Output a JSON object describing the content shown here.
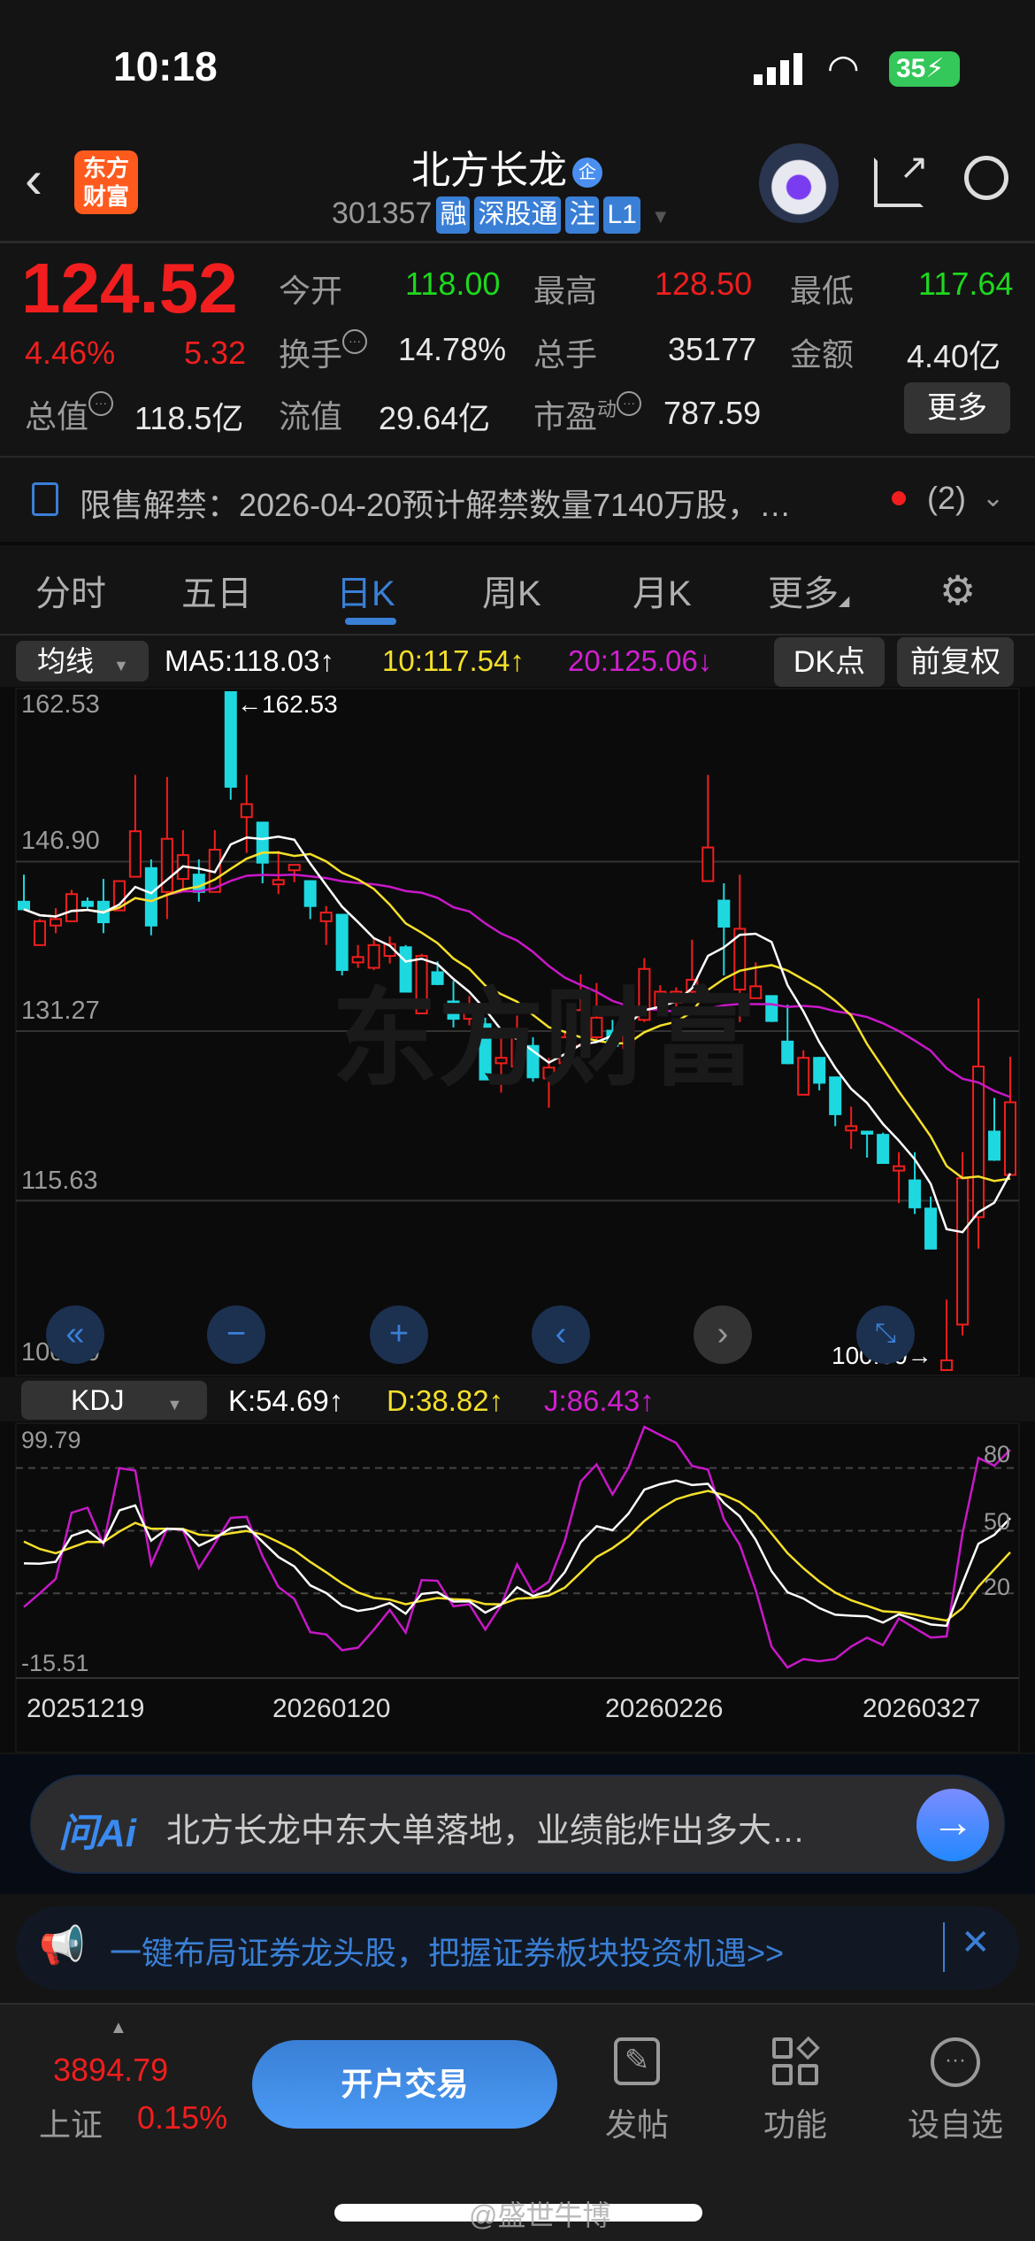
{
  "status": {
    "time": "10:18",
    "battery": "35"
  },
  "header": {
    "logo": "东方财富",
    "title": "北方长龙",
    "title_badge": "企",
    "code": "301357",
    "tags": [
      "融",
      "深股通",
      "注",
      "L1"
    ]
  },
  "quote": {
    "price": "124.52",
    "pct": "4.46%",
    "change": "5.32",
    "open_label": "今开",
    "open": "118.00",
    "high_label": "最高",
    "high": "128.50",
    "low_label": "最低",
    "low": "117.64",
    "turnover_label": "换手",
    "turnover": "14.78%",
    "volume_label": "总手",
    "volume": "35177",
    "amount_label": "金额",
    "amount": "4.40亿",
    "mcap_label": "总值",
    "mcap": "118.5亿",
    "float_label": "流值",
    "float": "29.64亿",
    "pe_label": "市盈",
    "pe_sup": "动",
    "pe": "787.59",
    "more": "更多"
  },
  "notice": {
    "text": "限售解禁：2026-04-20预计解禁数量7140万股，…",
    "count": "(2)"
  },
  "tabs": [
    "分时",
    "五日",
    "日K",
    "周K",
    "月K",
    "更多"
  ],
  "active_tab": 2,
  "ma_bar": {
    "selector": "均线",
    "ma5": "MA5:118.03↑",
    "ma10": "10:117.54↑",
    "ma20": "20:125.06↓",
    "dk": "DK点",
    "adjust": "前复权"
  },
  "kdj_bar": {
    "selector": "KDJ",
    "k": "K:54.69↑",
    "d": "D:38.82↑",
    "j": "J:86.43↑"
  },
  "colors": {
    "up": "#f01e1e",
    "down": "#1ed8e0",
    "ma5": "#ffffff",
    "ma10": "#f5e02a",
    "ma20": "#c818c8",
    "accent": "#3a7fd6"
  },
  "chart_data": {
    "type": "candlestick",
    "ylim": [
      100.0,
      162.53
    ],
    "y_ticks": [
      "162.53",
      "146.90",
      "131.27",
      "115.63",
      "100.00"
    ],
    "max_label": "←162.53",
    "min_label": "100.00→",
    "x_labels": [
      "20251219",
      "20260120",
      "20260226",
      "20260327"
    ],
    "ohlc": [
      [
        143.2,
        145.7,
        142.4,
        142.5
      ],
      [
        139.2,
        141.6,
        139.2,
        141.4
      ],
      [
        141.0,
        142.6,
        140.3,
        141.6
      ],
      [
        141.4,
        144.3,
        141.3,
        143.9
      ],
      [
        143.2,
        143.6,
        142.5,
        142.8
      ],
      [
        143.2,
        145.3,
        140.3,
        141.3
      ],
      [
        142.4,
        145.1,
        142.4,
        145.1
      ],
      [
        145.5,
        154.9,
        145.5,
        149.7
      ],
      [
        146.3,
        147.1,
        140.1,
        141.0
      ],
      [
        144.1,
        154.7,
        141.6,
        149.0
      ],
      [
        145.3,
        149.8,
        144.3,
        147.5
      ],
      [
        145.7,
        147.1,
        143.2,
        144.1
      ],
      [
        144.1,
        149.8,
        144.1,
        148.0
      ],
      [
        162.53,
        162.53,
        152.6,
        153.8
      ],
      [
        151.0,
        154.9,
        147.7,
        152.2
      ],
      [
        150.5,
        150.5,
        144.9,
        146.8
      ],
      [
        144.8,
        147.9,
        143.9,
        145.2
      ],
      [
        146.1,
        146.6,
        145.0,
        146.6
      ],
      [
        145.1,
        145.1,
        141.6,
        142.8
      ],
      [
        141.4,
        142.8,
        139.2,
        142.2
      ],
      [
        142.0,
        142.0,
        136.4,
        136.9
      ],
      [
        137.6,
        139.2,
        137.1,
        138.1
      ],
      [
        137.1,
        139.8,
        136.9,
        139.2
      ],
      [
        138.2,
        140.0,
        137.5,
        139.3
      ],
      [
        139.0,
        139.2,
        134.9,
        134.9
      ],
      [
        132.9,
        138.4,
        132.9,
        138.2
      ],
      [
        136.7,
        137.7,
        135.5,
        135.6
      ],
      [
        134.0,
        135.9,
        131.6,
        132.4
      ],
      [
        132.4,
        134.5,
        131.8,
        133.3
      ],
      [
        131.9,
        132.5,
        126.8,
        126.8
      ],
      [
        128.3,
        131.4,
        125.6,
        128.8
      ],
      [
        128.0,
        132.7,
        127.8,
        131.3
      ],
      [
        129.9,
        130.7,
        126.6,
        127.0
      ],
      [
        126.9,
        128.8,
        124.2,
        127.9
      ],
      [
        128.3,
        131.1,
        128.3,
        130.7
      ],
      [
        129.9,
        136.5,
        129.9,
        133.2
      ],
      [
        130.7,
        135.7,
        130.4,
        132.5
      ],
      [
        131.3,
        132.3,
        129.7,
        129.9
      ],
      [
        129.7,
        134.9,
        129.5,
        133.3
      ],
      [
        132.3,
        138.0,
        132.1,
        137.0
      ],
      [
        133.3,
        135.5,
        132.7,
        134.9
      ],
      [
        133.9,
        135.3,
        132.9,
        134.9
      ],
      [
        134.9,
        139.7,
        134.6,
        136.0
      ],
      [
        145.1,
        154.9,
        145.1,
        148.2
      ],
      [
        143.3,
        144.9,
        136.4,
        140.9
      ],
      [
        135.1,
        145.7,
        132.1,
        140.7
      ],
      [
        134.3,
        137.6,
        134.3,
        135.4
      ],
      [
        134.5,
        134.5,
        132.1,
        132.2
      ],
      [
        130.3,
        133.7,
        128.2,
        128.3
      ],
      [
        125.4,
        129.5,
        125.4,
        128.8
      ],
      [
        128.8,
        128.9,
        125.8,
        126.5
      ],
      [
        127.0,
        127.0,
        122.5,
        123.6
      ],
      [
        122.1,
        124.3,
        120.4,
        122.5
      ],
      [
        122.0,
        122.0,
        119.6,
        121.8
      ],
      [
        121.7,
        121.9,
        119.1,
        119.1
      ],
      [
        118.4,
        120.1,
        115.4,
        118.8
      ],
      [
        117.5,
        120.1,
        114.4,
        115.0
      ],
      [
        114.9,
        116.0,
        111.2,
        111.2
      ],
      [
        100.0,
        106.5,
        100.0,
        100.9
      ],
      [
        104.2,
        120.1,
        103.2,
        117.7
      ],
      [
        114.1,
        134.3,
        111.2,
        128.0
      ],
      [
        122.0,
        125.1,
        119.3,
        119.4
      ],
      [
        118.0,
        128.9,
        118.0,
        124.7
      ]
    ],
    "kdj": {
      "ylim": [
        -15.51,
        99.79
      ],
      "y_top": "99.79",
      "y_bottom": "-15.51",
      "levels": [
        "80",
        "50",
        "20"
      ]
    }
  },
  "ai": {
    "logo": "问Ai",
    "text": "北方长龙中东大单落地，业绩能炸出多大…"
  },
  "banner": {
    "text": "一键布局证券龙头股，把握证券板块投资机遇>>"
  },
  "bottom": {
    "index_value": "3894.79",
    "index_name": "上证",
    "index_pct": "0.15%",
    "trade": "开户交易",
    "post": "发帖",
    "func": "功能",
    "watch": "设自选"
  },
  "watermark": "@盛世牛博"
}
